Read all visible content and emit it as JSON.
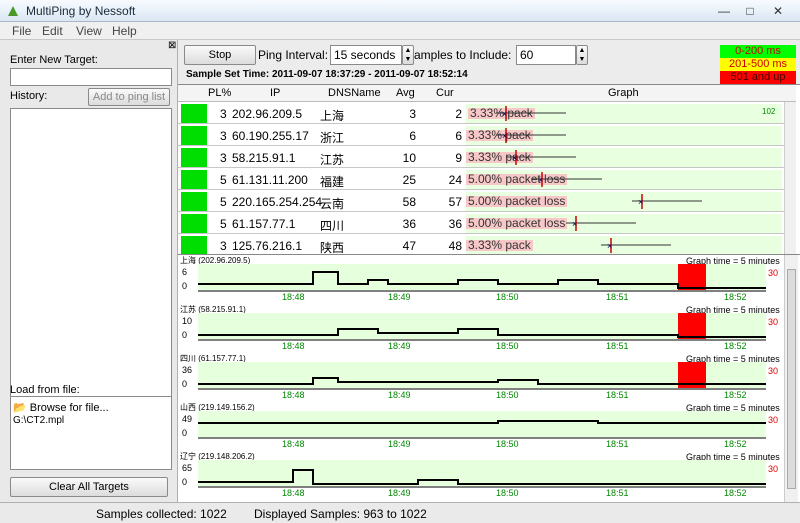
{
  "window": {
    "title": "MultiPing by Nessoft"
  },
  "menu": [
    "File",
    "Edit",
    "View",
    "Help"
  ],
  "left": {
    "new_target_label": "Enter New Target:",
    "history_label": "History:",
    "add_button": "Add to ping list",
    "load_label": "Load from file:",
    "browse": "Browse for file...",
    "file_item": "G:\\CT2.mpl",
    "clear_button": "Clear All Targets"
  },
  "controls": {
    "stop_button": "Stop",
    "interval_label": "Ping Interval:",
    "interval_value": "15 seconds",
    "samples_label": "amples to Include:",
    "samples_value": "60",
    "sample_set_time": "Sample Set Time: 2011-09-07 18:37:29 - 2011-09-07 18:52:14"
  },
  "legend": [
    {
      "text": "0-200 ms",
      "color": "#00ff00"
    },
    {
      "text": "201-500 ms",
      "color": "#ffff00"
    },
    {
      "text": "501 and up",
      "color": "#ff0000"
    }
  ],
  "columns": [
    "PL%",
    "IP",
    "DNSName",
    "Avg",
    "Cur",
    "Graph"
  ],
  "rows": [
    {
      "pl": "3",
      "ip": "202.96.209.5",
      "dns": "上海",
      "avg": "3",
      "cur": "2",
      "loss": "3.33% pack"
    },
    {
      "pl": "3",
      "ip": "60.190.255.17",
      "dns": "浙江",
      "avg": "6",
      "cur": "6",
      "loss": "3.33% pack"
    },
    {
      "pl": "3",
      "ip": "58.215.91.1",
      "dns": "江苏",
      "avg": "10",
      "cur": "9",
      "loss": "3.33% pack"
    },
    {
      "pl": "5",
      "ip": "61.131.11.200",
      "dns": "福建",
      "avg": "25",
      "cur": "24",
      "loss": "5.00% packet loss"
    },
    {
      "pl": "5",
      "ip": "220.165.254.254",
      "dns": "云南",
      "avg": "58",
      "cur": "57",
      "loss": "5.00% packet loss"
    },
    {
      "pl": "5",
      "ip": "61.157.77.1",
      "dns": "四川",
      "avg": "36",
      "cur": "36",
      "loss": "5.00% packet loss"
    },
    {
      "pl": "3",
      "ip": "125.76.216.1",
      "dns": "陕西",
      "avg": "47",
      "cur": "48",
      "loss": "3.33% pack"
    }
  ],
  "graph_scale_max": "102",
  "graphs": [
    {
      "title": "上海 (202.96.209.5)",
      "time": "Graph time = 5 minutes",
      "ymax": "30",
      "y1": "6",
      "y2": "0"
    },
    {
      "title": "江苏 (58.215.91.1)",
      "time": "Graph time = 5 minutes",
      "ymax": "30",
      "y1": "10",
      "y2": "0"
    },
    {
      "title": "四川 (61.157.77.1)",
      "time": "Graph time = 5 minutes",
      "ymax": "30",
      "y1": "36",
      "y2": "0"
    },
    {
      "title": "山西 (219.149.156.2)",
      "time": "Graph time = 5 minutes",
      "ymax": "30",
      "y1": "49",
      "y2": "0"
    },
    {
      "title": "辽宁 (219.148.206.2)",
      "time": "Graph time = 5 minutes",
      "ymax": "30",
      "y1": "65",
      "y2": "0"
    }
  ],
  "ticks": [
    "18:48",
    "18:49",
    "18:50",
    "18:51",
    "18:52"
  ],
  "status": {
    "collected": "Samples collected: 1022",
    "displayed": "Displayed Samples: 963 to 1022"
  }
}
